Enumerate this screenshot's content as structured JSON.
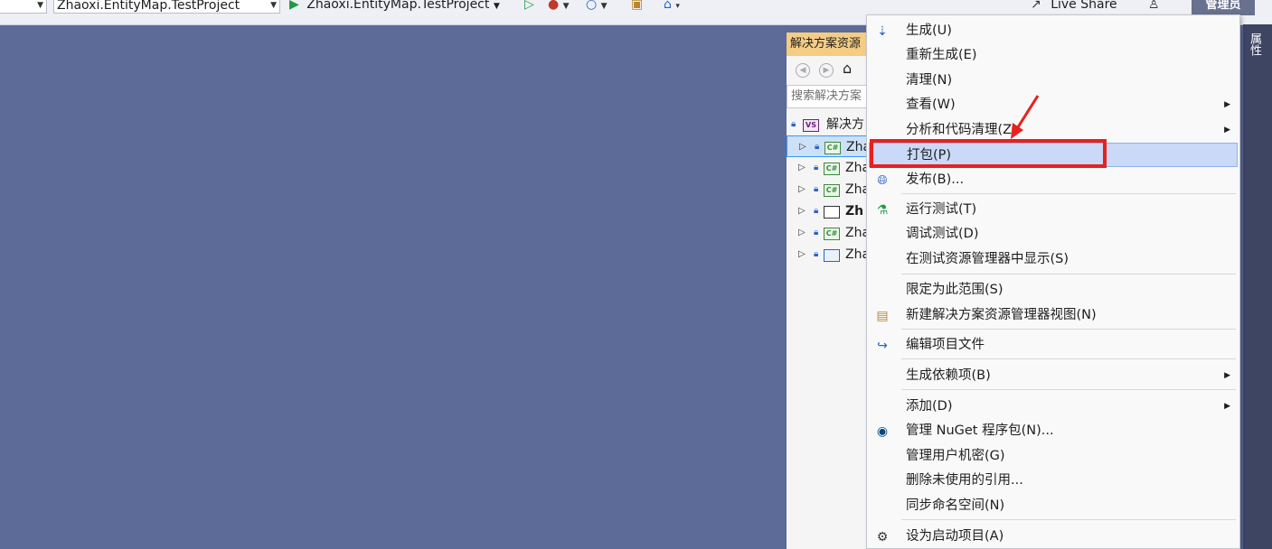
{
  "toolbar": {
    "startup_project": "Zhaoxi.EntityMap.TestProject",
    "run_target": "Zhaoxi.EntityMap.TestProject",
    "live_share": "Live Share",
    "admin_label": "管理员"
  },
  "right_strip": {
    "properties_tab": "属性"
  },
  "solution_explorer": {
    "title": "解决方案资源",
    "search_placeholder": "搜索解决方案",
    "root_label": "解决方",
    "projects": [
      {
        "label": "Zha",
        "icon": "csharp-project-icon",
        "icon_text": "C#",
        "selected": true,
        "bold": false
      },
      {
        "label": "Zha",
        "icon": "csharp-project-icon",
        "icon_text": "C#",
        "selected": false,
        "bold": false
      },
      {
        "label": "Zha",
        "icon": "csharp-project-icon",
        "icon_text": "C#",
        "selected": false,
        "bold": false
      },
      {
        "label": "Zh",
        "icon": "test-project-icon",
        "icon_text": "",
        "selected": false,
        "bold": true
      },
      {
        "label": "Zha",
        "icon": "csharp-project-icon",
        "icon_text": "C#",
        "selected": false,
        "bold": false
      },
      {
        "label": "Zha",
        "icon": "web-project-icon",
        "icon_text": "",
        "selected": false,
        "bold": false
      }
    ]
  },
  "context_menu": {
    "items": [
      {
        "label": "生成(U)",
        "icon": "build-icon",
        "submenu": false,
        "highlighted": false
      },
      {
        "label": "重新生成(E)",
        "icon": "",
        "submenu": false,
        "highlighted": false
      },
      {
        "label": "清理(N)",
        "icon": "",
        "submenu": false,
        "highlighted": false
      },
      {
        "label": "查看(W)",
        "icon": "",
        "submenu": true,
        "highlighted": false
      },
      {
        "label": "分析和代码清理(Z)",
        "icon": "",
        "submenu": true,
        "highlighted": false
      },
      {
        "label": "打包(P)",
        "icon": "",
        "submenu": false,
        "highlighted": true
      },
      {
        "label": "发布(B)...",
        "icon": "publish-globe-icon",
        "submenu": false,
        "highlighted": false
      },
      {
        "label": "运行测试(T)",
        "icon": "run-tests-icon",
        "submenu": false,
        "highlighted": false
      },
      {
        "label": "调试测试(D)",
        "icon": "",
        "submenu": false,
        "highlighted": false
      },
      {
        "label": "在测试资源管理器中显示(S)",
        "icon": "",
        "submenu": false,
        "highlighted": false
      },
      {
        "label": "限定为此范围(S)",
        "icon": "",
        "submenu": false,
        "highlighted": false
      },
      {
        "label": "新建解决方案资源管理器视图(N)",
        "icon": "new-view-icon",
        "submenu": false,
        "highlighted": false
      },
      {
        "label": "编辑项目文件",
        "icon": "edit-project-file-icon",
        "submenu": false,
        "highlighted": false
      },
      {
        "label": "生成依赖项(B)",
        "icon": "",
        "submenu": true,
        "highlighted": false
      },
      {
        "label": "添加(D)",
        "icon": "",
        "submenu": true,
        "highlighted": false
      },
      {
        "label": "管理 NuGet 程序包(N)...",
        "icon": "nuget-icon",
        "submenu": false,
        "highlighted": false
      },
      {
        "label": "管理用户机密(G)",
        "icon": "",
        "submenu": false,
        "highlighted": false
      },
      {
        "label": "删除未使用的引用...",
        "icon": "",
        "submenu": false,
        "highlighted": false
      },
      {
        "label": "同步命名空间(N)",
        "icon": "",
        "submenu": false,
        "highlighted": false
      },
      {
        "label": "设为启动项目(A)",
        "icon": "gear-icon",
        "submenu": false,
        "highlighted": false
      }
    ]
  },
  "colors": {
    "background": "#5d6b99",
    "annotation_red": "#e8211e",
    "highlight": "#c9d9f7",
    "solution_title": "#f5cc84"
  }
}
